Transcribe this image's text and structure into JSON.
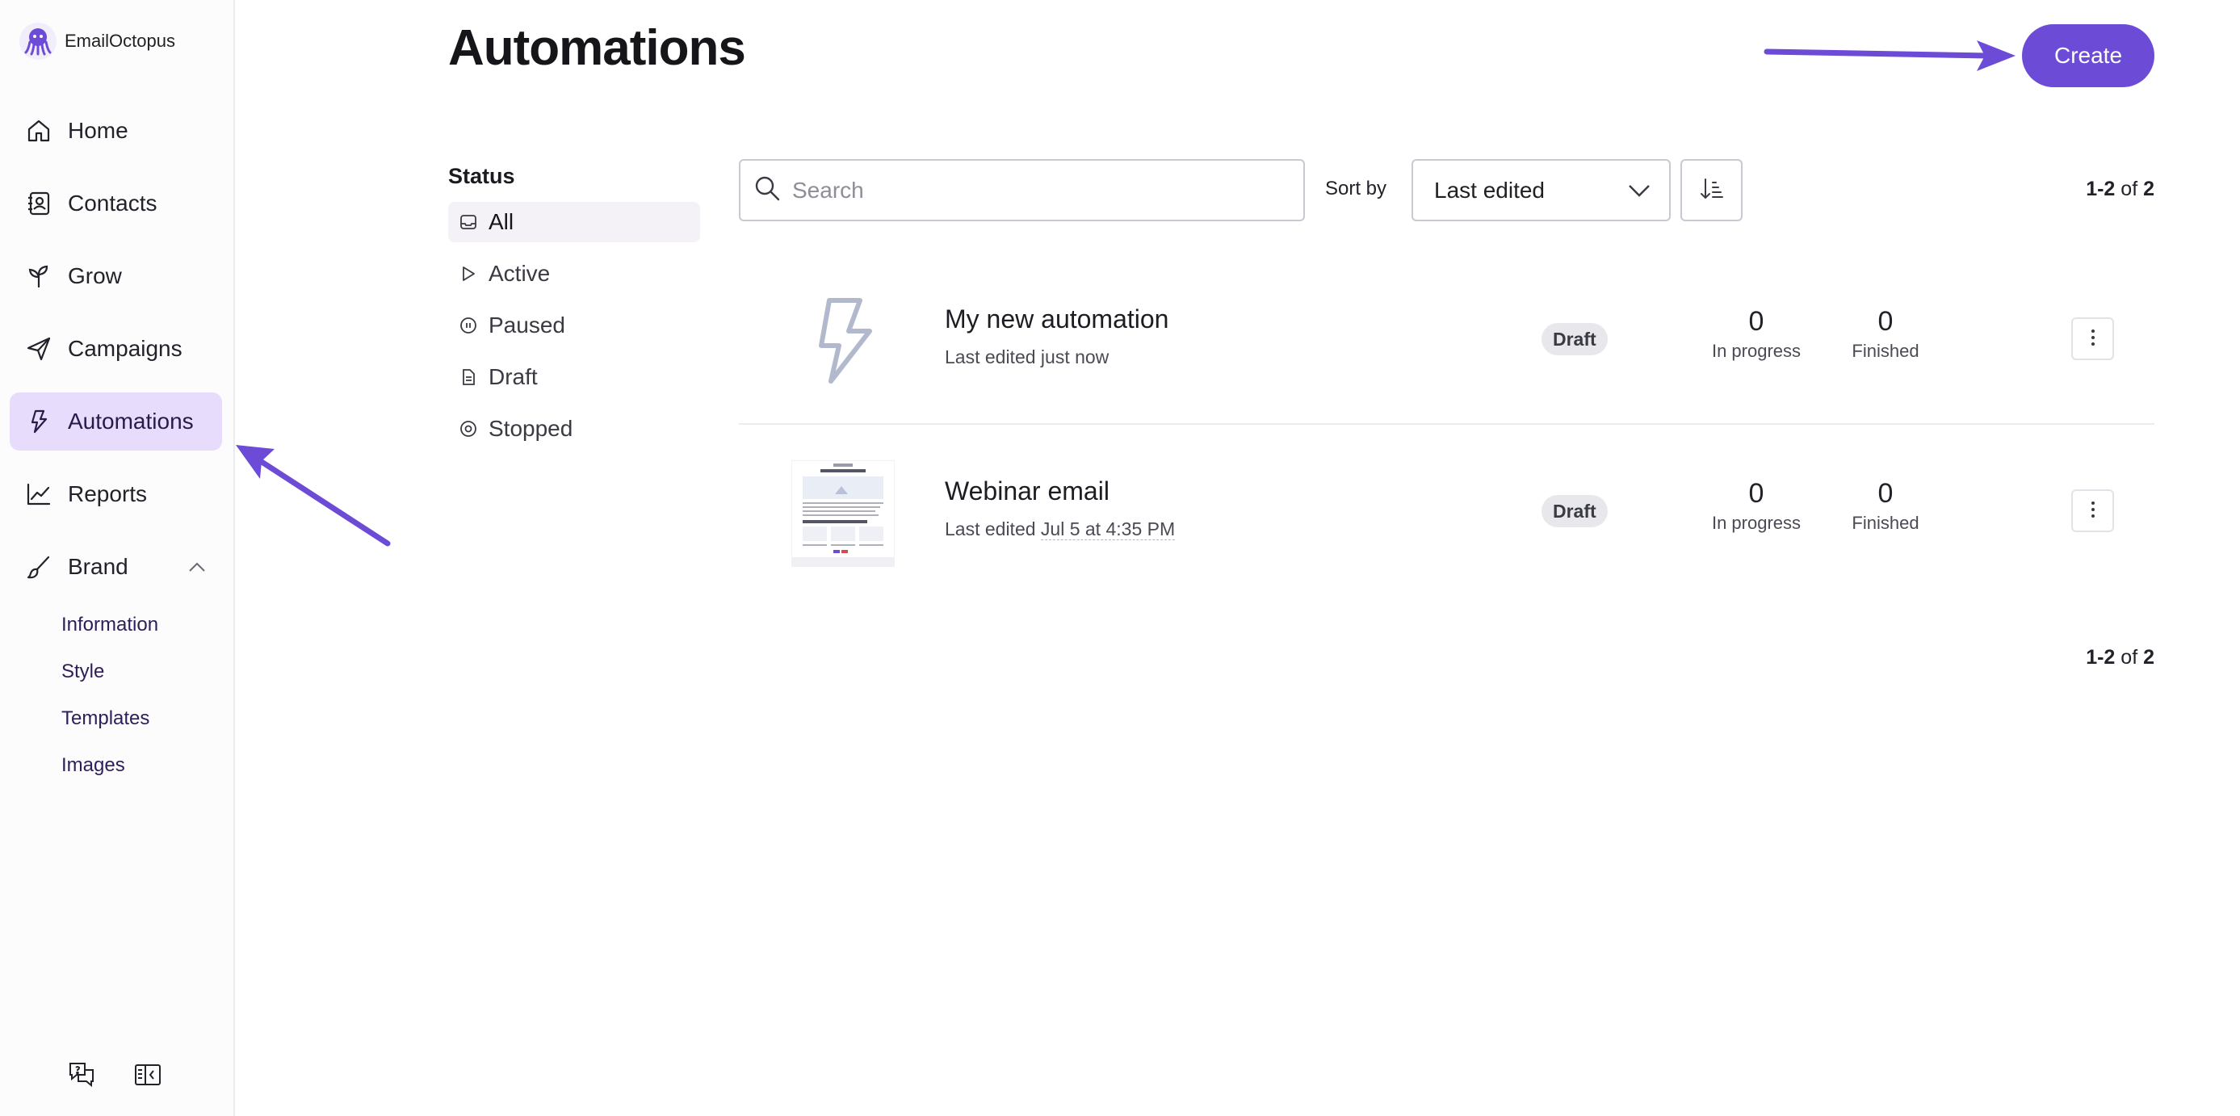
{
  "app": {
    "name": "EmailOctopus"
  },
  "sidebar": {
    "items": [
      {
        "label": "Home",
        "icon": "home-icon"
      },
      {
        "label": "Contacts",
        "icon": "contacts-icon"
      },
      {
        "label": "Grow",
        "icon": "sprout-icon"
      },
      {
        "label": "Campaigns",
        "icon": "send-icon"
      },
      {
        "label": "Automations",
        "icon": "lightning-icon",
        "active": true
      },
      {
        "label": "Reports",
        "icon": "chart-line-icon"
      },
      {
        "label": "Brand",
        "icon": "brush-icon",
        "expanded": true
      }
    ],
    "brand_subitems": [
      "Information",
      "Style",
      "Templates",
      "Images"
    ],
    "footer_icons": [
      "help-chat-icon",
      "collapse-sidebar-icon"
    ]
  },
  "header": {
    "title": "Automations",
    "create_label": "Create"
  },
  "filters": {
    "heading": "Status",
    "items": [
      {
        "label": "All",
        "icon": "inbox-icon",
        "active": true
      },
      {
        "label": "Active",
        "icon": "play-icon"
      },
      {
        "label": "Paused",
        "icon": "pause-circle-icon"
      },
      {
        "label": "Draft",
        "icon": "document-icon"
      },
      {
        "label": "Stopped",
        "icon": "stop-circle-icon"
      }
    ]
  },
  "toolbar": {
    "search_placeholder": "Search",
    "sort_label": "Sort by",
    "sort_value": "Last edited"
  },
  "pagination": {
    "range": "1-2",
    "of_text": " of ",
    "total": "2"
  },
  "automations": [
    {
      "title": "My new automation",
      "subtitle_prefix": "Last edited ",
      "subtitle_date": "just now",
      "status": "Draft",
      "in_progress": "0",
      "in_progress_label": "In progress",
      "finished": "0",
      "finished_label": "Finished",
      "thumbnail": "lightning-icon"
    },
    {
      "title": "Webinar email",
      "subtitle_prefix": "Last edited ",
      "subtitle_date": "Jul 5 at 4:35 PM",
      "status": "Draft",
      "in_progress": "0",
      "in_progress_label": "In progress",
      "finished": "0",
      "finished_label": "Finished",
      "thumbnail": "email-preview"
    }
  ],
  "colors": {
    "accent": "#6c4bd6",
    "active_nav_bg": "#e7dcfb",
    "badge_bg": "#e8e8ec"
  }
}
